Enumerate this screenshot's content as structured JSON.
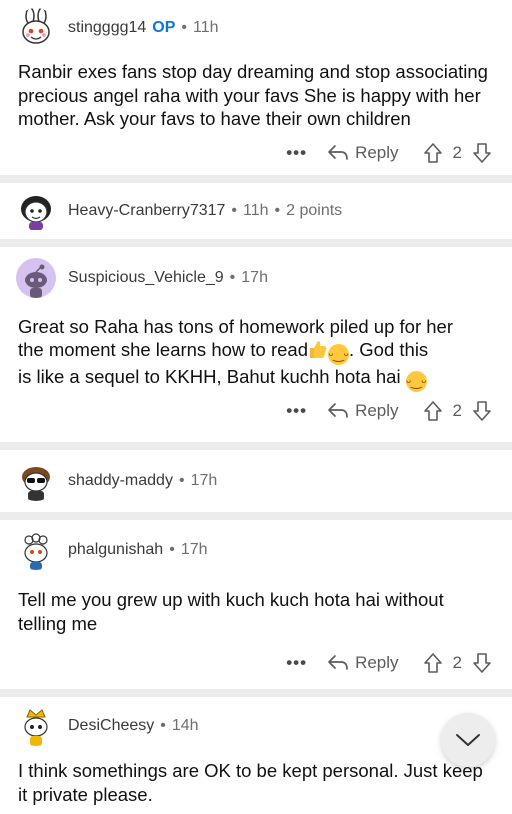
{
  "comments": [
    {
      "user": "stingggg14",
      "op": "OP",
      "age": "11h",
      "body": "Ranbir exes fans stop day dreaming and stop associating precious angel raha with your favs She is happy with her mother. Ask your favs to have their own children",
      "reply": "Reply",
      "score": "2",
      "more": "•••"
    },
    {
      "user": "Heavy-Cranberry7317",
      "age": "11h",
      "points": "2 points"
    },
    {
      "user": "Suspicious_Vehicle_9",
      "age": "17h",
      "body_line1": "Great so Raha has tons of homework piled up for her",
      "body_line2a": "the moment she learns how to read",
      "body_line2b": ". God this",
      "body_line3": "is like a sequel to KKHH, Bahut kuchh hota hai",
      "reply": "Reply",
      "score": "2",
      "more": "•••"
    },
    {
      "user": "shaddy-maddy",
      "age": "17h"
    },
    {
      "user": "phalgunishah",
      "age": "17h",
      "body": "Tell me you grew up with kuch kuch hota hai without telling me",
      "reply": "Reply",
      "score": "2",
      "more": "•••"
    },
    {
      "user": "DesiCheesy",
      "age": "14h",
      "body": "I think somethings are OK to be kept personal. Just keep it private please."
    }
  ],
  "icons": {
    "reply": "reply-arrow-icon",
    "upvote": "upvote-arrow-icon",
    "downvote": "downvote-arrow-icon",
    "more": "more-options-icon",
    "scroll": "chevron-down-icon"
  },
  "colors": {
    "op_badge": "#0b77d6",
    "separator": "#ececec",
    "avatar_purple": "#d6c2f0"
  }
}
